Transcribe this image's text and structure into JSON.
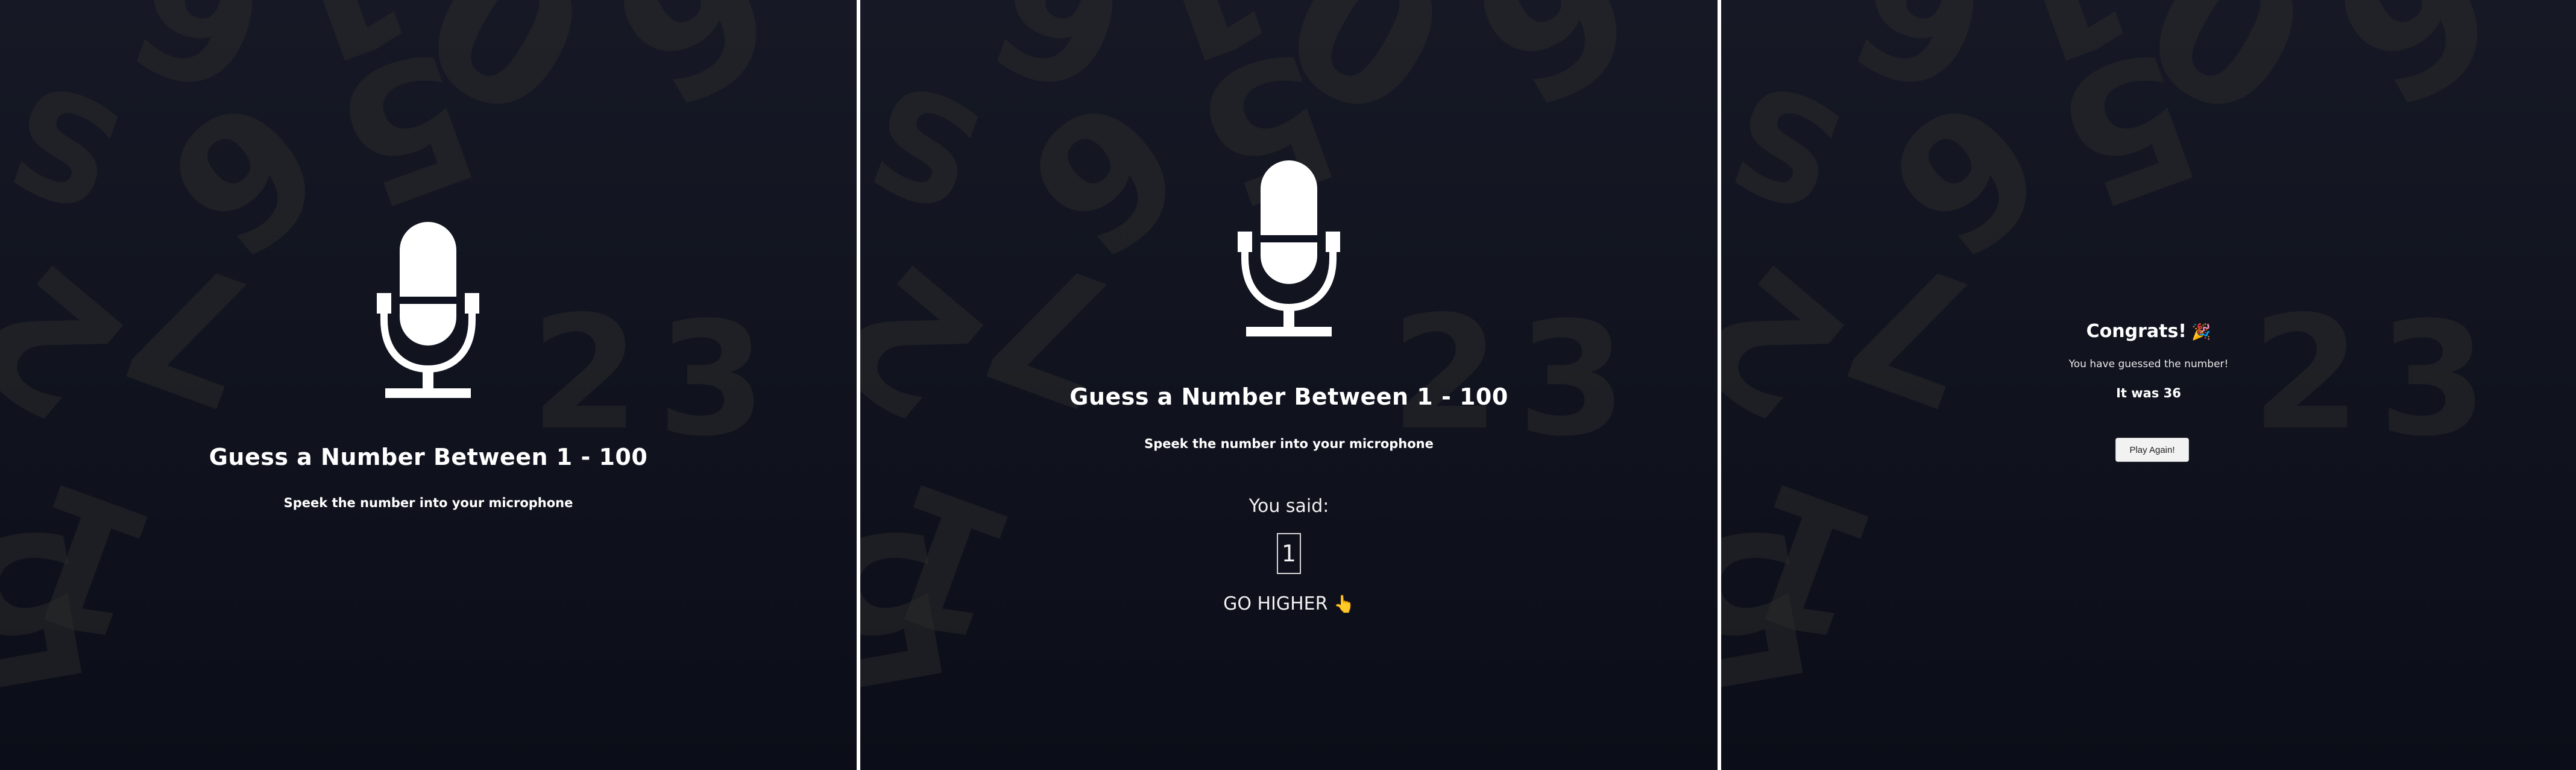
{
  "colors": {
    "background_top": "#161925",
    "background_bottom": "#0b0d18",
    "digit_decoration": "#2a2a2a",
    "text": "#ffffff",
    "button_background": "#f2f2f2"
  },
  "background_digits": [
    "9",
    "0",
    "1",
    "6",
    "0",
    "5",
    "S",
    "1",
    "6",
    "2",
    "6",
    "7",
    "5",
    "2",
    "3",
    "3",
    "1",
    "5",
    "9"
  ],
  "screens": [
    {
      "icon": "microphone-icon",
      "title": "Guess a Number Between 1 - 100",
      "subtitle": "Speek the number into your microphone"
    },
    {
      "icon": "microphone-icon",
      "title": "Guess a Number Between 1 - 100",
      "subtitle": "Speek the number into your microphone",
      "you_said_label": "You said:",
      "spoken_number": "1",
      "feedback": "GO HIGHER",
      "feedback_icon": "pointing-hand-icon"
    },
    {
      "congrats": "Congrats!",
      "congrats_icon": "party-popper-icon",
      "message": "You have guessed the number!",
      "result": "It was 36",
      "button_label": "Play Again!"
    }
  ]
}
